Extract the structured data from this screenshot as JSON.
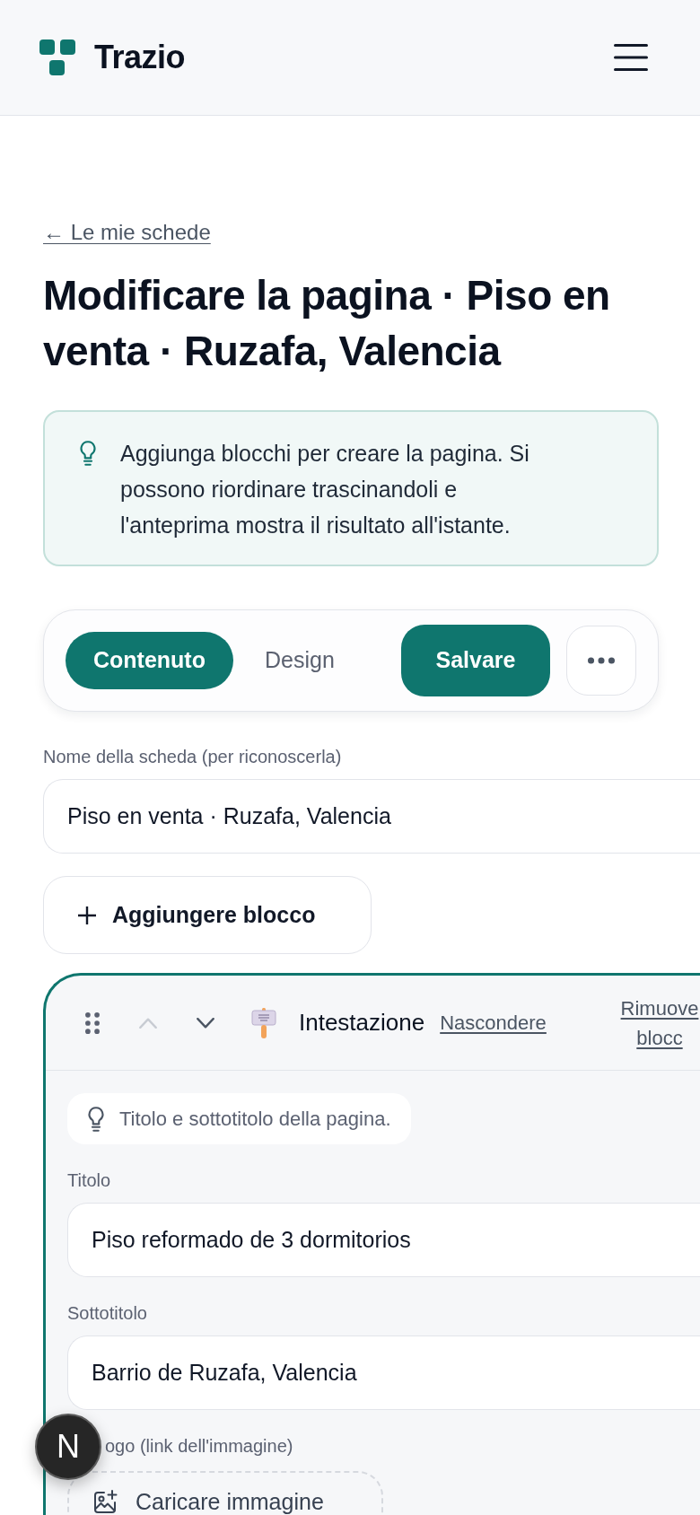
{
  "header": {
    "brand": "Trazio"
  },
  "back_link": "← Le mie schede",
  "title": "Modificare la pagina · Piso en venta · Ruzafa, Valencia",
  "callout": "Aggiunga blocchi per creare la pagina. Si possono riordinare trascinandoli e l'anteprima mostra il risultato all'istante.",
  "toolbar": {
    "tabs": [
      {
        "label": "Contenuto",
        "selected": true
      },
      {
        "label": "Design",
        "selected": false
      }
    ],
    "save_button": "Salvare"
  },
  "name_field": {
    "label": "Nome della scheda (per riconoscerla)",
    "value": "Piso en venta · Ruzafa, Valencia"
  },
  "add_block_button": "Aggiungere blocco",
  "blocks": [
    {
      "title": "Intestazione",
      "selected": true,
      "controls": [
        {
          "kind": "up",
          "disabled": true
        },
        {
          "kind": "down",
          "disabled": false
        }
      ],
      "hide_link": "Nascondere",
      "remove_link": "Rimuove blocc",
      "tip": "Titolo e sottotitolo della pagina.",
      "fields": [
        {
          "kind": "text",
          "label": "Titolo",
          "value": "Piso reformado de 3 dormitorios"
        },
        {
          "kind": "text",
          "label": "Sottotitolo",
          "value": "Barrio de Ruzafa, Valencia"
        },
        {
          "kind": "upload",
          "label": "ogo (link dell'immagine)",
          "button": "Caricare immagine"
        }
      ]
    }
  ],
  "dev_indicator": {
    "label": "N"
  }
}
